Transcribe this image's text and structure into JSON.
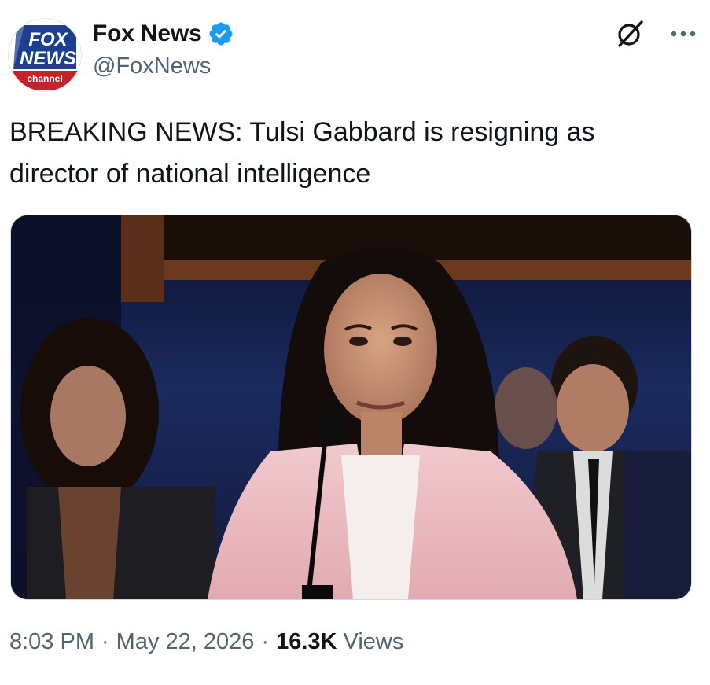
{
  "author": {
    "display_name": "Fox News",
    "handle": "@FoxNews",
    "verified": true,
    "avatar_logo_text": [
      "FOX",
      "NEWS",
      "channel"
    ]
  },
  "icons": {
    "verified": "verified-badge-icon",
    "grok": "grok-icon",
    "more": "more-options-icon"
  },
  "tweet": {
    "text": "BREAKING NEWS: Tulsi Gabbard is resigning as\ndirector of national intelligence"
  },
  "meta": {
    "time": "8:03 PM",
    "separator": "·",
    "date": "May 22, 2026",
    "views_count": "16.3K",
    "views_label": "Views"
  },
  "colors": {
    "text_primary": "#0f1419",
    "text_secondary": "#536471",
    "verified_blue": "#1d9bf0",
    "fox_blue": "#1d3f8f",
    "fox_red": "#c8202a"
  }
}
